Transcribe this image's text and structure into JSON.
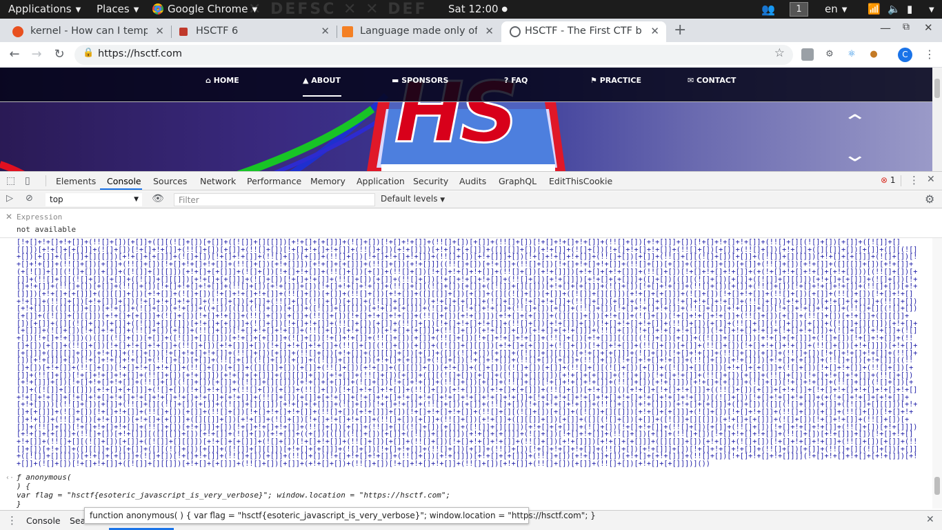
{
  "topbar": {
    "applications": "Applications",
    "places": "Places",
    "app": "Google Chrome",
    "clock": "Sat 12:00",
    "workspace": "1",
    "lang": "en"
  },
  "tabs": [
    {
      "title": "kernel - How can I tempora",
      "favicon_color": "#e8501f"
    },
    {
      "title": "HSCTF 6",
      "favicon_color": "#c0392b"
    },
    {
      "title": "Language made only of br",
      "favicon_color": "#f48024"
    },
    {
      "title": "HSCTF - The First CTF by",
      "favicon_color": "#5f6368"
    }
  ],
  "toolbar": {
    "url": "https://hsctf.com",
    "profile": "C"
  },
  "site": {
    "nav": [
      "HOME",
      "ABOUT",
      "SPONSORS",
      "FAQ",
      "PRACTICE",
      "CONTACT"
    ],
    "logo": "HS"
  },
  "devtools": {
    "tabs": [
      "Elements",
      "Console",
      "Sources",
      "Network",
      "Performance",
      "Memory",
      "Application",
      "Security",
      "Audits",
      "GraphQL",
      "EditThisCookie"
    ],
    "error_count": "1",
    "context": "top",
    "filter_placeholder": "Filter",
    "levels": "Default levels",
    "expression_label": "Expression",
    "expression_value": "not available"
  },
  "console": {
    "jsfuck": "[!+[]+!+[]+!+[]]+(!![]+[])[+[]]+([][(![]+[])[+[]]+([![]]+[][[]])[+!+[]+[+[]]]+(![]+[])[!+[]+!+[]]+(!![]+[])[+[]]+(!![]+[])[!+[]+!+[]+!+[]]+(!![]+[])[+!+[]]]+[])[!+[]+!+[]+!+[]]+(!![]+[][(![]+[])[+[]]+([![]]+[][[]])[+!+[]+[+[]]]+(![]+[])[!+[]+!+[]]+(!![]+[])[+[]]+(!![]+[])[!+[]+!+[]+!+[]]+(!![]+[])[+!+[]]])[+!+[]+[+[]]]+([][[]]+[])[+!+[]]+(![]+[])[!+[]+!+[]+!+[]]+(!![]+[])[+[]]+(!![]+[])[+!+[]]+([][[]]+[])[+[]]+([][(![]+[])[+[]]+([![]]+[][[]])[+!+[]+[+[]]]+(![]+[])[!+[]+!+[]]+(!![]+[])[+[]]+(!![]+[])[!+[]+!+[]+!+[]]+(!![]+[])[+!+[]]]+[])[!+[]+!+[]+!+[]]+(!![]+[])[+[]]+(!![]+[][(![]+[])[+[]]+([![]]+[][[]])[+!+[]+[+[]]]+(![]+[])[!+[]+!+[]]+(!![]+[])[+[]]+(!![]+[])[!+[]+!+[]+!+[]]+(!![]+[])[+!+[]]])[+!+[]+[+[]]]+(!![]+[])[+!+[]]]((!![]+[])[+!+[]]+(!![]+[])[!+[]+!+[]+!+[]]+(!![]+[])[+[]]+([][[]]+[])[+[]]+(!![]+[])[+!+[]]+([][[]]+[])[+!+[]]+(+[![]]+[][(![]+[])[+[]]+([![]]+[][[]])[+!+[]+[+[]]]+(![]+[])[!+[]+!+[]]+(!![]+[])[+[]]+(!![]+[])[!+[]+!+[]+!+[]]+(!![]+[])[+!+[]]])[+!+[]+[+!+[]]]+(!![]+[])[!+[]+!+[]+!+[]]+(+(!+[]+!+[]+!+[]+[+!+[]]))[(!![]+[])[+[]]+(!![]+[][(![]+[])[+[]]+([![]]+[][[]])[+!+[]+[+[]]]+(![]+[])[!+[]+!+[]]+(!![]+[])[+[]]+(!![]+[])[!+[]+!+[]+!+[]]+(!![]+[])[+!+[]]])[+!+[]+[+[]]]+([]+[])[([][(![]+[])[+[]]+([![]]+[][[]])[+!+[]+[+[]]]+(![]+[])[!+[]+!+[]]+(!![]+[])[+[]]+(!![]+[])[!+[]+!+[]+!+[]]+(!![]+[])[+!+[]]]+[])[!+[]+!+[]+!+[]]+(!![]+[][(![]+[])[+[]]+([![]]+[][[]])[+!+[]+[+[]]]+(![]+[])[!+[]+!+[]]+(!![]+[])[+[]]+(!![]+[])[!+[]+!+[]+!+[]]+(!![]+[])[+!+[]]])[+!+[]+[+[]]]+([][[]]+[])[+!+[]]+(![]+[])[!+[]+!+[]+!+[]]+(!![]+[])[+[]]+(!![]+[])[+!+[]]+([][[]]+[])[+[]]+([][(![]+[])[+[]]+([![]]+[][[]])[+!+[]+[+[]]]+(![]+[])[!+[]+!+[]]+(!![]+[])[+[]]+(!![]+[])[!+[]+!+[]+!+[]]+(!![]+[])[+!+[]]]+[])[!+[]+!+[]+!+[]]+(!![]+[])[+[]]+(!![]+[][(![]+[])[+[]]+([![]]+[][[]])[+!+[]+[+[]]]+(![]+[])[!+[]+!+[]]+(!![]+[])[+[]]+(!![]+[])[!+[]+!+[]+!+[]]+(!![]+[])[+!+[]]])[+!+[]+[+[]]]+(!![]+[])[+!+[]]][([][[]]+[])[+!+[]]+(![]+[])[+!+[]]+((+[])[([][(![]+[])[+[]]+([![]]+[][[]])[+!+[]+[+[]]]+(![]+[])[!+[]+!+[]]+(!![]+[])[+[]]+(!![]+[])[!+[]+!+[]+!+[]]+(!![]+[])[+!+[]]]+[])[!+[]+!+[]+!+[]]+(!![]+[][(![]+[])[+[]]+([![]]+[][[]])[+!+[]+[+[]]]+(![]+[])[!+[]+!+[]]+(!![]+[])[+[]]+(!![]+[])[!+[]+!+[]+!+[]]+(!![]+[])[+!+[]]])[+!+[]+[+[]]]+([][[]]+[])[+!+[]]+(![]+[])[!+[]+!+[]+!+[]]+(!![]+[])[+[]]+(!![]+[])[+!+[]]+([][[]]+[])[+[]]+([][(![]+[])[+[]]+([![]]+[][[]])[+!+[]+[+[]]]+(![]+[])[!+[]+!+[]]+(!![]+[])[+[]]+(!![]+[])[!+[]+!+[]+!+[]]+(!![]+[])[+!+[]]]+[])[!+[]+!+[]+!+[]]+(!![]+[])[+[]]+(!![]+[][(![]+[])[+[]]+([![]]+[][[]])[+!+[]+[+[]]]+(![]+[])[!+[]+!+[]]+(!![]+[])[+[]]+(!![]+[])[!+[]+!+[]+!+[]]+(!![]+[])[+!+[]]])[+!+[]+[+[]]]+(!![]+[])[+!+[]]]+[])[+!+[]+[+!+[]]]+(!![]+[])[!+[]+!+[]+!+[]]]](!+[]+!+[]+!+[]+[!+[]+!+[]])+(![]+[])[+!+[]]+(![]+[])[!+[]+!+[]])()([][(![]+[])[+[]]+([![]]+[][[]])[+!+[]+[+[]]]+(![]+[])[!+[]+!+[]]+(!![]+[])[+[]]+(!![]+[])[!+[]+!+[]+!+[]]+(!![]+[])[+!+[]]][([][(![]+[])[+[]]+([![]]+[][[]])[+!+[]+[+[]]]+(![]+[])[!+[]+!+[]]+(!![]+[])[+[]]+(!![]+[])[!+[]+!+[]+!+[]]+(!![]+[])[+!+[]]]+[])[!+[]+!+[]+!+[]]+(!![]+[][(![]+[])[+[]]+([![]]+[][[]])[+!+[]+[+[]]]+(![]+[])[!+[]+!+[]]+(!![]+[])[+[]]+(!![]+[])[!+[]+!+[]+!+[]]+(!![]+[])[+!+[]]])[+!+[]+[+[]]]+([][[]]+[])[+!+[]]+(![]+[])[!+[]+!+[]+!+[]]+(!![]+[])[+[]]+(!![]+[])[+!+[]]+([][[]]+[])[+[]]+([][(![]+[])[+[]]+([![]]+[][[]])[+!+[]+[+[]]]+(![]+[])[!+[]+!+[]]+(!![]+[])[+[]]+(!![]+[])[!+[]+!+[]+!+[]]+(!![]+[])[+!+[]]]+[])[!+[]+!+[]+!+[]]+(!![]+[])[+[]]+(!![]+[][(![]+[])[+[]]+([![]]+[][[]])[+!+[]+[+[]]]+(![]+[])[!+[]+!+[]]+(!![]+[])[+[]]+(!![]+[])[!+[]+!+[]+!+[]]+(!![]+[])[+!+[]]])[+!+[]+[+[]]]+(!![]+[])[+!+[]]]((!![]+[])[+!+[]]+(!![]+[])[!+[]+!+[]+!+[]]+(!![]+[])[+[]]+([][[]]+[])[+[]]+(!![]+[])[+!+[]]+([][[]]+[])[+!+[]]+([]+[])[(![]+[])[+[]]+(!![]+[][(![]+[])[+[]]+([![]]+[][[]])[+!+[]+[+[]]]+(![]+[])[!+[]+!+[]]+(!![]+[])[+[]]+(!![]+[])[!+[]+!+[]+!+[]]+(!![]+[])[+!+[]]])[+!+[]+[+[]]]+([][[]]+[])[+!+[]]+(!![]+[])[+[]]+([][(![]+[])[+[]]+([![]]+[][[]])[+!+[]+[+[]]]+(![]+[])[!+[]+!+[]]+(!![]+[])[+[]]+(!![]+[])[!+[]+!+[]+!+[]]+(!![]+[])[+!+[]]]+[])[!+[]+!+[]+!+[]]+(!![]+[][(![]+[])[+[]]+([![]]+[][[]])[+!+[]+[+[]]]+(![]+[])[!+[]+!+[]]+(!![]+[])[+[]]+(!![]+[])[!+[]+!+[]+!+[]]+(!![]+[])[+!+[]]])[+!+[]+[+[]]]+(![]+[])[!+[]+!+[]]+(!![]+[][(![]+[])[+[]]+([![]]+[][[]])[+!+[]+[+[]]]+(![]+[])[!+[]+!+[]]+(!![]+[])[+[]]+(!![]+[])[!+[]+!+[]+!+[]]+(!![]+[])[+!+[]]])[+!+[]+[+[]]]+(!![]+[])[+!+[]]]()[+!+[]+[!+[]+!+[]]]+((!![]+[])[+[]]+[+!+[]]+[!+[]+!+[]+!+[]+!+[]+!+[]+!+[]+!+[]]+[!+[]+!+[]+!+[]+!+[]+!+[]+!+[]+!+[]]+[+!+[]]+(!![]+[])[+[]]+[+!+[]]+[!+[]+!+[]+!+[]+!+[]+!+[]+!+[]+!+[]+!+[]]+[!+[]+!+[]+!+[]+!+[]+!+[]+!+[]+!+[]+!+[]])[(![]+[])[!+[]+!+[]+!+[]]+(+(!+[]+!+[]+[+!+[]]+[+!+[]]))[(!![]+[])[+[]]+(!![]+[][(![]+[])[+[]]+([![]]+[][[]])[+!+[]+[+[]]]+(![]+[])[!+[]+!+[]]+(!![]+[])[+[]]+(!![]+[])[!+[]+!+[]+!+[]]+(!![]+[])[+!+[]]])[+!+[]+[+[]]]+([]+[])[([][(![]+[])[+[]]+([![]]+[][[]])[+!+[]+[+[]]]+(![]+[])[!+[]+!+[]]+(!![]+[])[+[]]+(!![]+[])[!+[]+!+[]+!+[]]+(!![]+[])[+!+[]]]+[])[!+[]+!+[]+!+[]]+(!![]+[][(![]+[])[+[]]+([![]]+[][[]])[+!+[]+[+[]]]+(![]+[])[!+[]+!+[]]+(!![]+[])[+[]]+(!![]+[])[!+[]+!+[]+!+[]]+(!![]+[])[+!+[]]])[+!+[]+[+[]]]+([][[]]+[])[+!+[]]+(![]+[])[!+[]+!+[]+!+[]]+(!![]+[])[+[]]+(!![]+[])[+!+[]]+([][[]]+[])[+[]]+([][(![]+[])[+[]]+([![]]+[][[]])[+!+[]+[+[]]]+(![]+[])[!+[]+!+[]]+(!![]+[])[+[]]+(!![]+[])[!+[]+!+[]+!+[]]+(!![]+[])[+!+[]]]+[])[!+[]+!+[]+!+[]]+(!![]+[])[+[]]+(!![]+[][(![]+[])[+[]]+([![]]+[][[]])[+!+[]+[+[]]]+(![]+[])[!+[]+!+[]]+(!![]+[])[+[]]+(!![]+[])[!+[]+!+[]+!+[]]+(!![]+[])[+!+[]]])[+!+[]+[+[]]]+(!![]+[])[+!+[]]][([][[]]+[])[+!+[]]+(![]+[])[+!+[]]+((+[])[([][(![]+[])[+[]]+([![]]+[][[]])[+!+[]+[+[]]]+(![]+[])[!+[]+!+[]]+(!![]+[])[+[]]+(!![]+[])[!+[]+!+[]+!+[]]+(!![]+[])[+!+[]]]+[])[!+[]+!+[]+!+[]]+(!![]+[][(![]+[])[+[]]+([![]]+[][[]])[+!+[]+[+[]]]+(![]+[])[!+[]+!+[]]+(!![]+[])[+[]]+(!![]+[])[!+[]+!+[]+!+[]]+(!![]+[])[+!+[]]])[+!+[]+[+[]]]+([][[]]+[])[+!+[]]+(![]+[])[!+[]+!+[]+!+[]]+(!![]+[])[+[]]+(!![]+[])[+!+[]]+([][[]]+[])[+[]]+([][(![]+[])[+[]]+([![]]+[][[]])[+!+[]+[+[]]]+(![]+[])[!+[]+!+[]]+(!![]+[])[+[]]+(!![]+[])[!+[]+!+[]+!+[]]+(!![]+[])[+!+[]]]+[])[!+[]+!+[]+!+[]]+(!![]+[])[+[]]+(!![]+[][(![]+[])[+[]]+([![]]+[][[]])[+!+[]+[+[]]]+(![]+[])[!+[]+!+[]]+(!![]+[])[+[]]+(!![]+[])[!+[]+!+[]+!+[]]+(!![]+[])[+!+[]]])[+!+[]+[+[]]]+(!![]+[])[+!+[]]]+[])[+!+[]+[+!+[]]]+(!![]+[])[!+[]+!+[]+!+[]]]](!+[]+!+[]+!+[]+[+!+[]])[+!+[]]+(![]+[])[!+[]+!+[]]+([![]]+[][[]])[+!+[]+[+[]]]+(!![]+[])[+[]]+(+!+[]+[])+(!![]+[])[!+[]+!+[]+!+[]]+(!![]+[])[+!+[]]+(!![]+[])[+[]]+(!![]+[])[+!+[]+[+[]]])]())",
    "result_line1": "ƒ anonymous(",
    "result_line2": ") {",
    "result_line3": "var flag = \"hsctf{esoteric_javascript_is_very_verbose}\"; window.location = \"https://hsctf.com\";",
    "result_line4": "}"
  },
  "drawer": {
    "tab1": "Console",
    "tab2": "Sea"
  },
  "tooltip": "function anonymous( ) { var flag = \"hsctf{esoteric_javascript_is_very_verbose}\"; window.location = \"https://hsctf.com\"; }"
}
